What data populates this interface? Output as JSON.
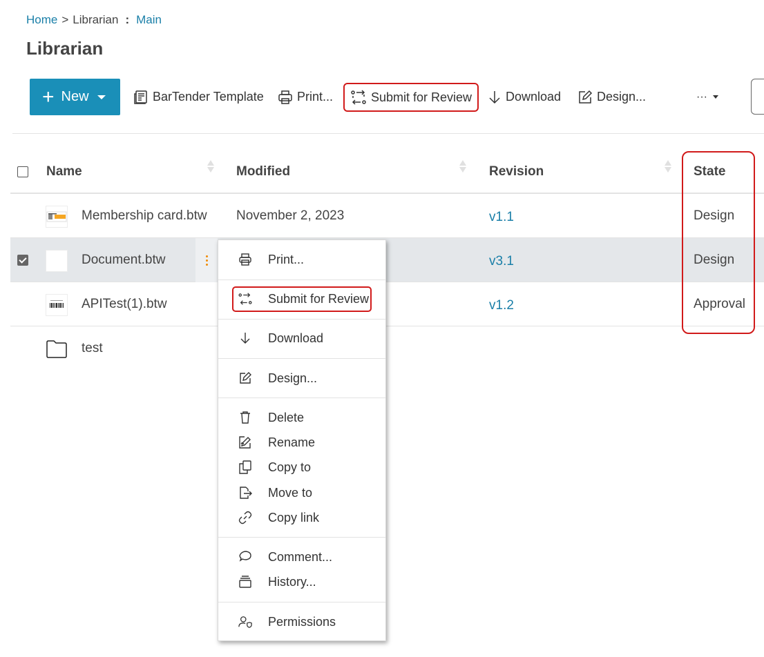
{
  "breadcrumb": {
    "home": "Home",
    "sep": ">",
    "librarian": "Librarian",
    "colon": ":",
    "main": "Main"
  },
  "page": {
    "title": "Librarian"
  },
  "toolbar": {
    "new_label": "New",
    "new_plus": "+",
    "bartender_template": "BarTender Template",
    "print": "Print...",
    "submit_for_review": "Submit for Review",
    "download": "Download",
    "design": "Design...",
    "more": "···"
  },
  "table": {
    "headers": {
      "name": "Name",
      "modified": "Modified",
      "revision": "Revision",
      "state": "State"
    },
    "rows": [
      {
        "name": "Membership card.btw",
        "modified": "November 2, 2023",
        "revision": "v1.1",
        "state": "Design",
        "selected": false,
        "thumb": "membership-card-thumbnail"
      },
      {
        "name": "Document.btw",
        "modified": "",
        "revision": "v3.1",
        "state": "Design",
        "selected": true,
        "thumb": "blank-thumbnail"
      },
      {
        "name": "APITest(1).btw",
        "modified": "",
        "revision": "v1.2",
        "state": "Approval",
        "selected": false,
        "thumb": "barcode-thumbnail"
      },
      {
        "name": "test",
        "modified": "",
        "revision": "",
        "state": "",
        "selected": false,
        "thumb": "folder-icon"
      }
    ]
  },
  "context_menu": {
    "print": "Print...",
    "submit_for_review": "Submit for Review",
    "download": "Download",
    "design": "Design...",
    "delete": "Delete",
    "rename": "Rename",
    "copy_to": "Copy to",
    "move_to": "Move to",
    "copy_link": "Copy link",
    "comment": "Comment...",
    "history": "History...",
    "permissions": "Permissions"
  },
  "colors": {
    "accent": "#1a8fb8",
    "link": "#1a7fa8",
    "highlight": "#d11a1a",
    "kebab": "#f08a00",
    "selected_row": "#e4e7ea"
  }
}
